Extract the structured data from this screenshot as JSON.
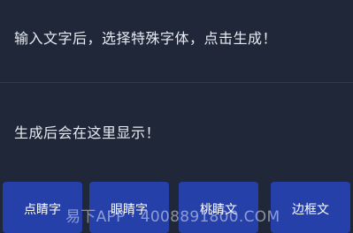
{
  "input": {
    "placeholder": "输入文字后，选择特殊字体，点击生成！"
  },
  "output": {
    "placeholder": "生成后会在这里显示！"
  },
  "buttons": [
    {
      "label": "点睛字"
    },
    {
      "label": "眼睛字"
    },
    {
      "label": "桃睛文"
    },
    {
      "label": "边框文"
    }
  ],
  "watermark": "易下APP · 4008891800.COM",
  "colors": {
    "background": "#1f2739",
    "button": "#2540a8",
    "text": "#e8ebf1"
  }
}
